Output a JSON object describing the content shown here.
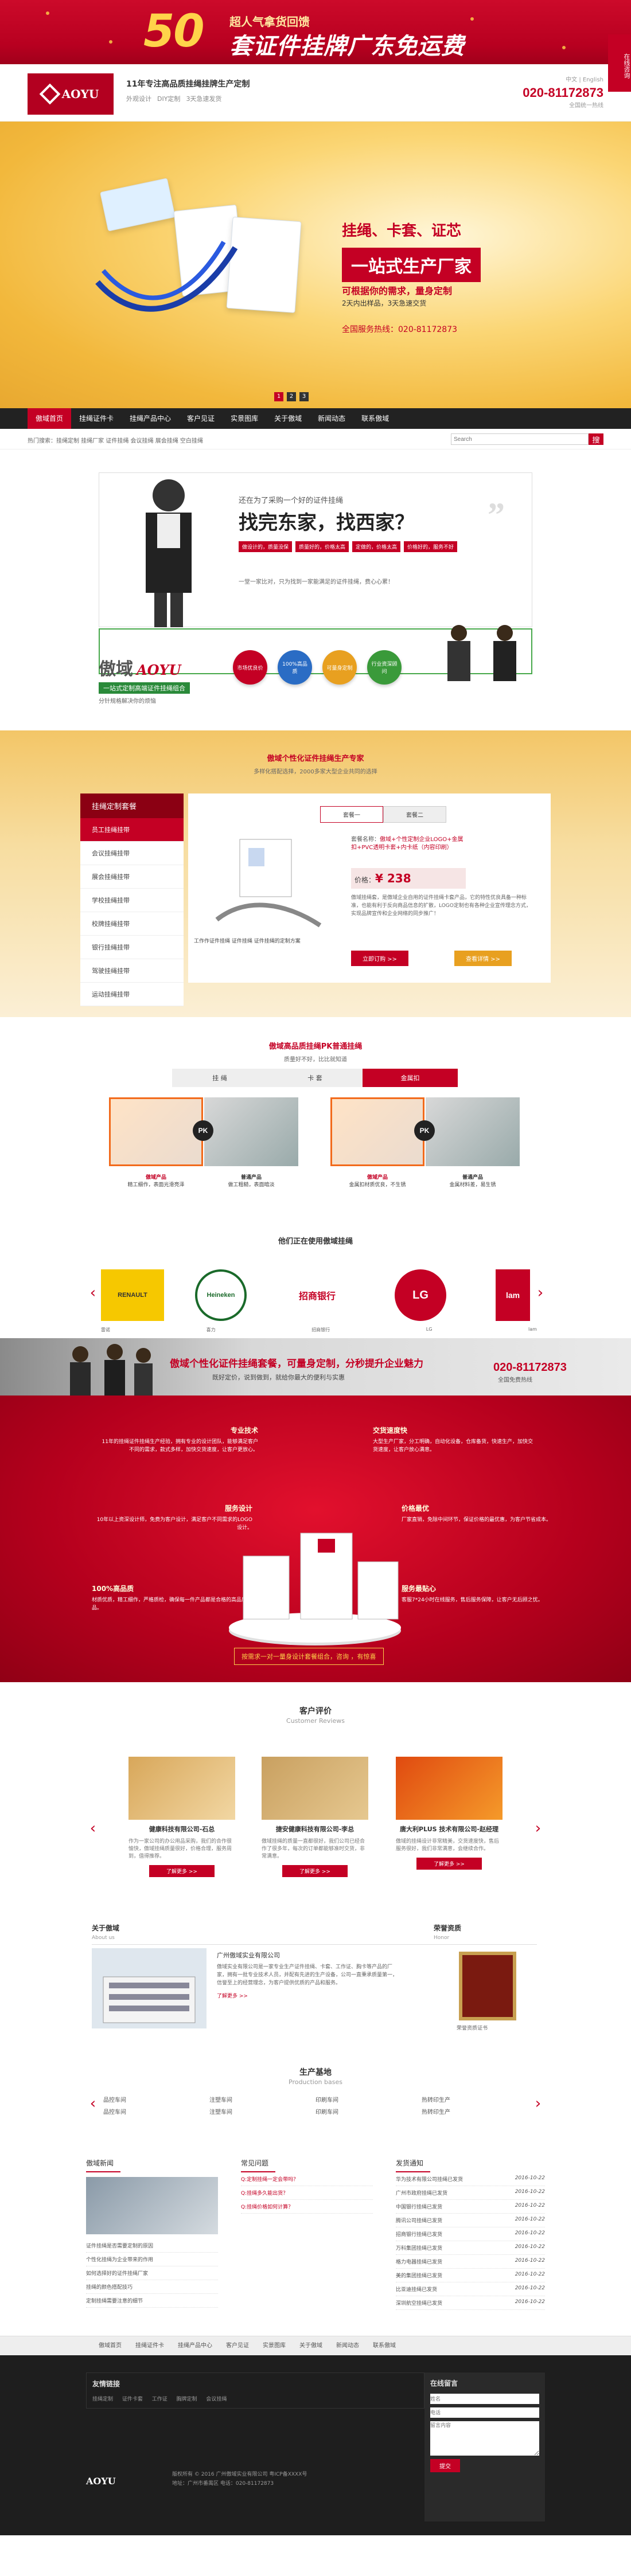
{
  "promo": {
    "number": "50",
    "line1": "超人气拿货回馈",
    "line2": "套证件挂牌广东免运费"
  },
  "side_float": {
    "label": "在线咨询"
  },
  "header": {
    "logo_text": "AOYU",
    "slogan": "11年专注高品质挂绳挂牌生产定制",
    "tags": [
      "外观设计",
      "DIY定制",
      "3天急速发货"
    ],
    "lang": "中文 | English",
    "phone": "020-81172873",
    "phone_sub": "全国统一热线"
  },
  "hero": {
    "title1": "挂绳、卡套、证芯",
    "title2": "一站式生产厂家",
    "title3": "可根据你的需求，量身定制",
    "title4": "2天内出样品，3天急速交货",
    "title5": "全国服务热线：020-81172873",
    "dots": [
      "1",
      "2",
      "3"
    ]
  },
  "nav": {
    "items": [
      "傲域首页",
      "挂绳证件卡",
      "挂绳产品中心",
      "客户见证",
      "实景图库",
      "关于傲域",
      "新闻动态",
      "联系傲域"
    ]
  },
  "crumb": {
    "text": "热门搜索：挂绳定制 挂绳厂家 证件挂绳 会议挂绳 展会挂绳 空白挂绳",
    "search_placeholder": "Search",
    "search_btn": "搜"
  },
  "intro": {
    "q1": "还在为了采购一个好的证件挂绳",
    "q2": "找完东家，找西家？",
    "tags": [
      "做设计的，质量没保",
      "质量好的，价格太高",
      "定做的，价格太高",
      "价格好的，服务不好"
    ],
    "q3": "一堂一家比对，只为找到一家能满足的证件挂绳，费心心累！",
    "brand_cn": "傲域",
    "brand_en": "AOYU",
    "brand_line": "一站式定制高端证件挂绳组合",
    "brand_sub": "分针规格解决你的烦恼",
    "circles": [
      "市场优良价",
      "100%高品质",
      "可量身定制",
      "行业资深顾问"
    ],
    "circle_colors": [
      "#c40024",
      "#2a6cc4",
      "#e8a020",
      "#3a9a3a"
    ]
  },
  "custom": {
    "title": "傲域个性化证件挂绳生产专家",
    "subtitle": "多样化搭配选择，2000多家大型企业共同的选择",
    "side_title": "挂绳定制套餐",
    "side_items": [
      "员工挂绳挂带",
      "会议挂绳挂带",
      "展会挂绳挂带",
      "学校挂绳挂带",
      "校牌挂绳挂带",
      "银行挂绳挂带",
      "驾驶挂绳挂带",
      "运动挂绳挂带"
    ],
    "tabs": [
      "套餐一",
      "套餐二"
    ],
    "pname_label": "套餐名称：",
    "pname": "傲域+个性定制企业LOGO+金属扣+PVC透明卡套+内卡纸（内容印刷）",
    "price_label": "价格：",
    "price": "¥ 238",
    "desc": "傲域挂绳套，是傲域企业自用的证件挂绳卡套产品，它的特性优良具备一种标准，也能有利于反向商品信息的扩散，LOGO定制也有各种企业宣传理念方式，实现品牌宣传和企业网络的同步推广！",
    "caption": "工作作证件挂绳 证件挂绳 证件挂绳的定制方案",
    "btn1": "立即订购 >>",
    "btn2": "查看详情 >>"
  },
  "pk": {
    "title": "傲域高品质挂绳PK普通挂绳",
    "subtitle": "质量好不好，比比就知道",
    "tabs": [
      "挂 绳",
      "卡 套",
      "金属扣"
    ],
    "badge": "PK",
    "labels": [
      {
        "t": "傲域产品",
        "s": "精工细作，表面光滑亮泽"
      },
      {
        "t": "普通产品",
        "s": "做工粗糙，表面暗淡"
      },
      {
        "t": "傲域产品",
        "s": "金属扣材质优良，不生锈"
      },
      {
        "t": "普通产品",
        "s": "金属材料差，易生锈"
      }
    ]
  },
  "brands": {
    "title": "他们正在使用傲域挂绳",
    "items": [
      "雷诺",
      "喜力",
      "招商银行",
      "LG",
      "lam"
    ],
    "logos": [
      "RENAULT",
      "Heineken",
      "招商银行",
      "LG",
      "lam"
    ]
  },
  "strip": {
    "title": "傲域个性化证件挂绳套餐，可量身定制，分秒提升企业魅力",
    "sub": "既好定价，说到做到，就给你最大的便利与实惠",
    "phone": "020-81172873",
    "phone_sub": "全国免费热线"
  },
  "features": {
    "items": [
      {
        "t": "专业技术",
        "d": "11年的挂绳证件挂绳生产经验，拥有专业的设计团队，能够满足客户不同的需求，款式多样，加快交货速度，让客户更放心。"
      },
      {
        "t": "交货速度快",
        "d": "大型生产厂家，分工明确，自动化设备，仓库备货，快速生产，加快交货速度，让客户放心满意。"
      },
      {
        "t": "服务设计",
        "d": "10年以上资深设计师，免费为客户设计，满足客户不同需求的LOGO设计。"
      },
      {
        "t": "价格最优",
        "d": "厂家直销，免除中间环节，保证价格的最优惠，为客户节省成本。"
      },
      {
        "t": "100%高品质",
        "d": "材质优质，精工细作，严格质检，确保每一件产品都是合格的高品质产品。"
      },
      {
        "t": "服务最贴心",
        "d": "客服7*24小时在线服务，售后服务保障，让客户无后顾之忧。"
      }
    ],
    "btn": "按需求一对一量身设计套餐组合，咨询 ，有惊喜"
  },
  "reviews": {
    "title": "客户评价",
    "en": "Customer Reviews",
    "items": [
      {
        "name": "健康科技有限公司-石总",
        "text": "作为一家公司的办公用品采购，我们的合作很愉快，傲域挂绳质量很好，价格合理，服务周到，值得推荐。"
      },
      {
        "name": "捷安健康科技有限公司-李总",
        "text": "傲域挂绳的质量一直都很好，我们公司已经合作了很多年，每次的订单都能够准时交货，非常满意。"
      },
      {
        "name": "唐大利PLUS 技术有限公司-赵经理",
        "text": "傲域的挂绳设计非常精美，交货速度快，售后服务很好，我们非常满意，会继续合作。"
      }
    ],
    "btn": "了解更多 >>"
  },
  "about": {
    "title": "关于傲域",
    "en": "About us",
    "company": "广州傲域实业有限公司",
    "text": "傲域实业有限公司是一家专业生产证件挂绳、卡套、工作证、胸卡等产品的厂家，拥有一批专业技术人员，并配有先进的生产设备，公司一直秉承质量第一，信誉至上的经营理念，为客户提供优质的产品和服务。",
    "more": "了解更多 >>",
    "honor_title": "荣誉资质",
    "honor_en": "Honor",
    "honor_cap": "荣誉资质证书"
  },
  "bases": {
    "title": "生产基地",
    "en": "Production bases",
    "items": [
      "品控车间",
      "注塑车间",
      "印刷车间",
      "热转印生产",
      "品控车间",
      "注塑车间",
      "印刷车间",
      "热转印生产"
    ]
  },
  "news": {
    "col1": {
      "title": "傲域新闻",
      "items": [
        "证件挂绳是否需要定制的原因",
        "个性化挂绳为企业带来的作用",
        "如何选择好的证件挂绳厂家",
        "挂绳的颜色搭配技巧",
        "定制挂绳需要注意的细节"
      ]
    },
    "col2": {
      "title": "常见问题",
      "items": [
        "Q:定制挂绳一定会带吗？",
        "Q:挂绳多久能出货？",
        "Q:挂绳价格如何计算？"
      ]
    },
    "col3": {
      "title": "发货通知",
      "items": [
        "华为技术有限公司挂绳已发货",
        "广州市政府挂绳已发货",
        "中国银行挂绳已发货",
        "腾讯公司挂绳已发货",
        "招商银行挂绳已发货",
        "万科集团挂绳已发货",
        "格力电器挂绳已发货",
        "美的集团挂绳已发货",
        "比亚迪挂绳已发货",
        "深圳航空挂绳已发货"
      ],
      "date": "2016-10-22"
    }
  },
  "footer_nav": {
    "items": [
      "傲域首页",
      "挂绳证件卡",
      "挂绳产品中心",
      "客户见证",
      "实景图库",
      "关于傲域",
      "新闻动态",
      "联系傲域"
    ]
  },
  "footer": {
    "links_title": "友情链接",
    "links": [
      "挂绳定制",
      "证件卡套",
      "工作证",
      "胸牌定制",
      "会议挂绳"
    ],
    "msg_title": "在线留言",
    "ph_name": "姓名",
    "ph_phone": "电话",
    "ph_msg": "留言内容",
    "submit": "提交",
    "copy1": "版权所有 © 2016 广州傲域实业有限公司 粤ICP备XXXX号",
    "copy2": "地址：广州市番禺区 电话：020-81172873",
    "logo": "AOYU"
  }
}
